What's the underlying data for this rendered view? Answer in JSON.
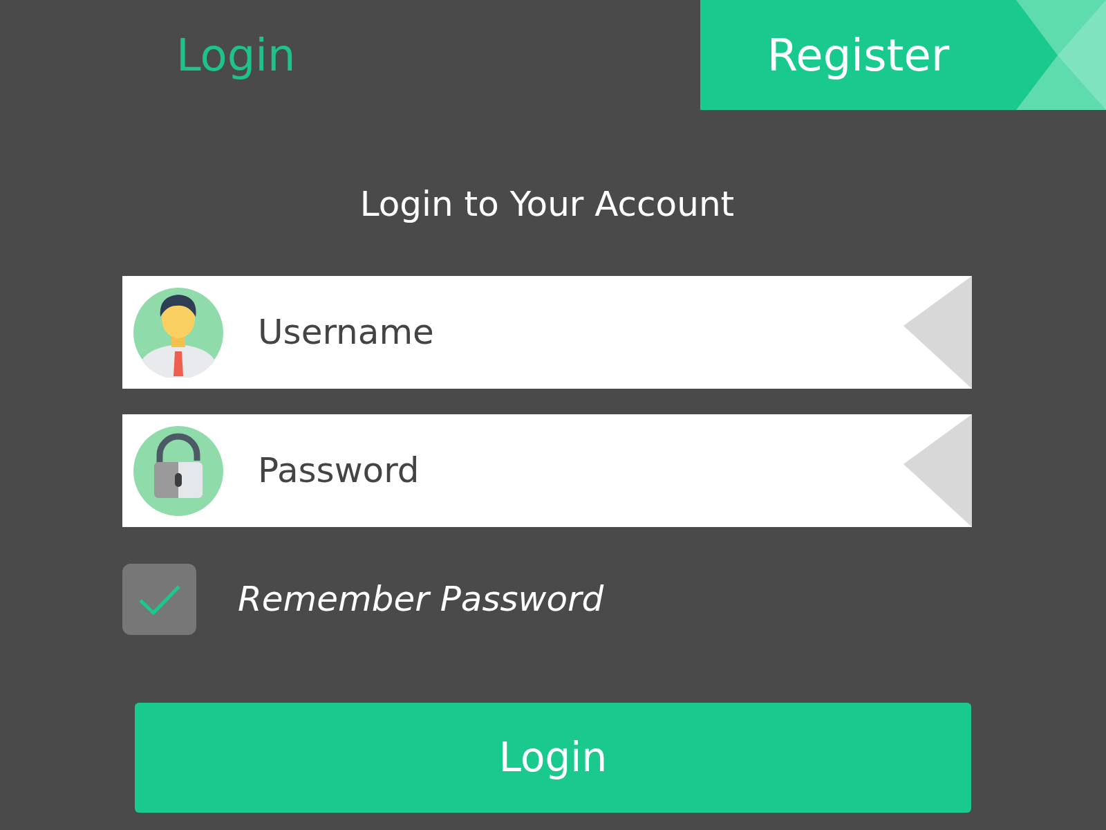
{
  "tabs": [
    {
      "label": "Login",
      "selected": true
    },
    {
      "label": "Register",
      "selected": false
    }
  ],
  "heading": "Login to Your Account",
  "fields": [
    {
      "kind": "user",
      "placeholder": "Username"
    },
    {
      "kind": "lock",
      "placeholder": "Password"
    }
  ],
  "remember": {
    "label": "Remember Password",
    "checked": true
  },
  "login_button": "Login"
}
